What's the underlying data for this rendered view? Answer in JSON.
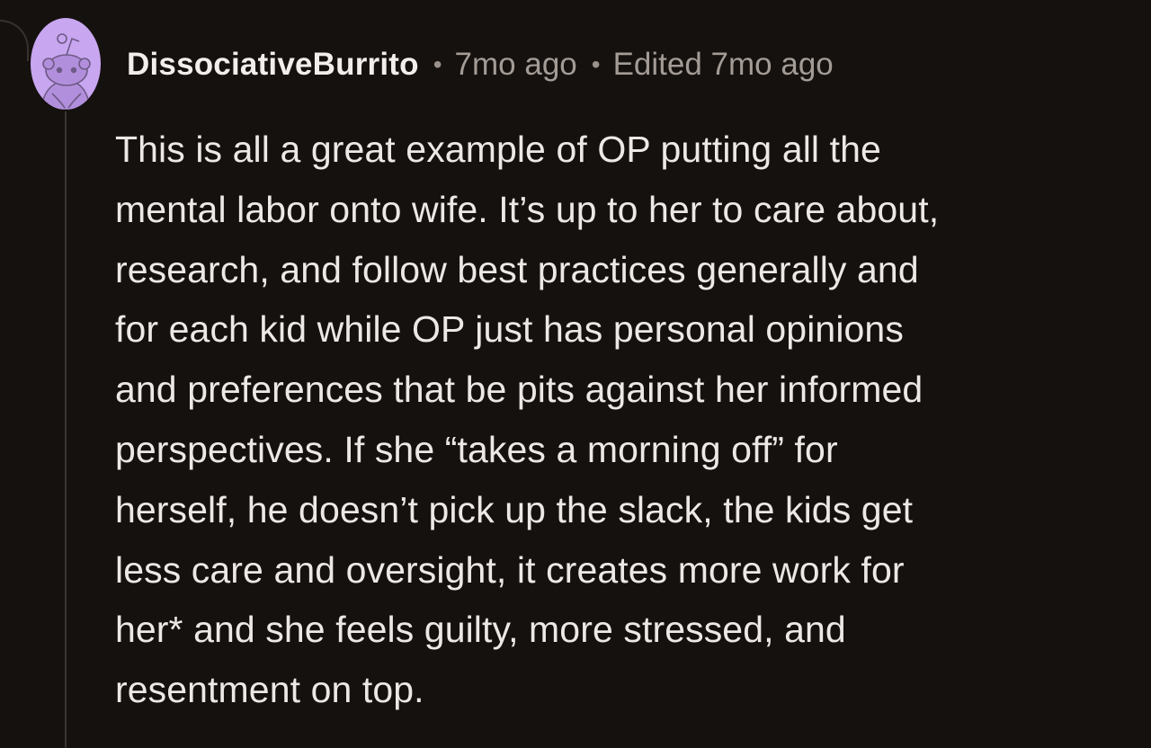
{
  "comment": {
    "author": "DissociativeBurrito",
    "separator": "•",
    "timestamp": "7mo ago",
    "edited": "Edited 7mo ago",
    "avatar_icon": "snoo-avatar-icon",
    "colors": {
      "background": "#15110f",
      "avatar_bg": "#c8a6f0",
      "text": "#ece8e5",
      "meta": "#a39c96"
    },
    "body_lines": [
      "This is all a great example of OP putting all the",
      "mental labor onto wife. It’s up to her to care about,",
      "research, and follow best practices generally and",
      "for each kid while OP just has personal opinions",
      "and preferences that be pits against her informed",
      "perspectives. If she “takes a morning off” for",
      "herself, he doesn’t pick up the slack, the kids get",
      "less care and oversight, it creates more work for",
      "her* and she feels guilty, more stressed, and",
      "resentment on top."
    ]
  }
}
